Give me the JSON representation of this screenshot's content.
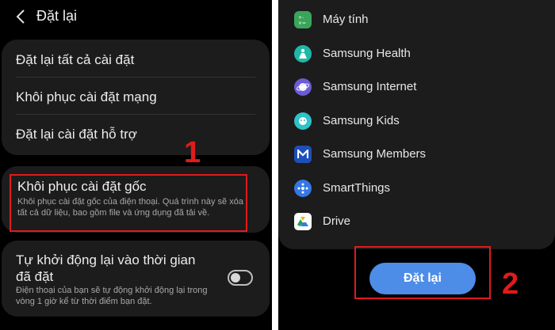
{
  "header": {
    "title": "Đặt lại"
  },
  "reset_options": [
    {
      "label": "Đặt lại tất cả cài đặt"
    },
    {
      "label": "Khôi phục cài đặt mạng"
    },
    {
      "label": "Đặt lại cài đặt hỗ trợ"
    }
  ],
  "factory_reset": {
    "title": "Khôi phục cài đặt gốc",
    "description": "Khôi phục cài đặt gốc của điện thoại. Quá trình này sẽ xóa tất cả dữ liệu, bao gồm file và ứng dụng đã tải về."
  },
  "auto_restart": {
    "title": "Tự khởi động lại vào thời gian đã đặt",
    "description": "Điện thoại của bạn sẽ tự động khởi động lại trong vòng 1 giờ kể từ thời điểm bạn đặt.",
    "enabled": false
  },
  "annotations": {
    "step1": "1",
    "step2": "2"
  },
  "apps": [
    {
      "label": "Máy tính",
      "icon": "calculator-icon",
      "color": "#3aa55a"
    },
    {
      "label": "Samsung Health",
      "icon": "health-icon",
      "color": "#1fb8a6"
    },
    {
      "label": "Samsung Internet",
      "icon": "internet-icon",
      "color": "#6b5bd6"
    },
    {
      "label": "Samsung Kids",
      "icon": "kids-icon",
      "color": "#2fc3c8"
    },
    {
      "label": "Samsung Members",
      "icon": "members-icon",
      "color": "#1e4fb8"
    },
    {
      "label": "SmartThings",
      "icon": "smartthings-icon",
      "color": "#3578e5"
    },
    {
      "label": "Drive",
      "icon": "drive-icon",
      "color": "#ffffff"
    }
  ],
  "reset_button": {
    "label": "Đặt lại"
  },
  "colors": {
    "highlight": "#e01b1b",
    "accent": "#4d8de8",
    "card": "#1c1c1c"
  }
}
